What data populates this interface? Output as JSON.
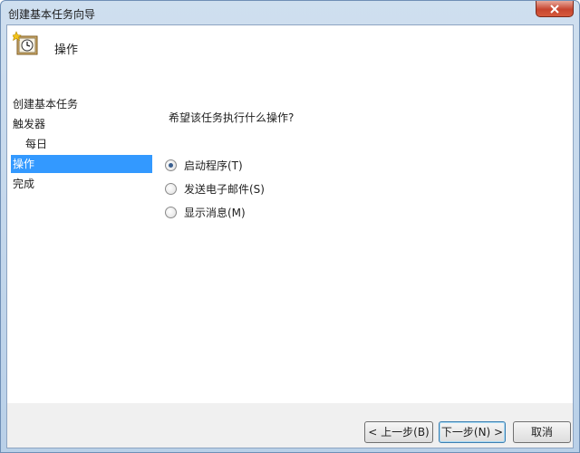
{
  "window": {
    "title": "创建基本任务向导"
  },
  "header": {
    "title": "操作",
    "icon": "clock-icon"
  },
  "sidebar": {
    "items": [
      {
        "label": "创建基本任务"
      },
      {
        "label": "触发器"
      },
      {
        "label": "每日"
      },
      {
        "label": "操作",
        "selected": true
      },
      {
        "label": "完成"
      }
    ]
  },
  "content": {
    "question": "希望该任务执行什么操作?",
    "options": [
      {
        "label": "启动程序(T)",
        "checked": true
      },
      {
        "label": "发送电子邮件(S)",
        "checked": false
      },
      {
        "label": "显示消息(M)",
        "checked": false
      }
    ]
  },
  "buttons": {
    "back": "< 上一步(B)",
    "next": "下一步(N) >",
    "cancel": "取消"
  },
  "colors": {
    "selection": "#3399ff",
    "close_button": "#c7452f"
  }
}
